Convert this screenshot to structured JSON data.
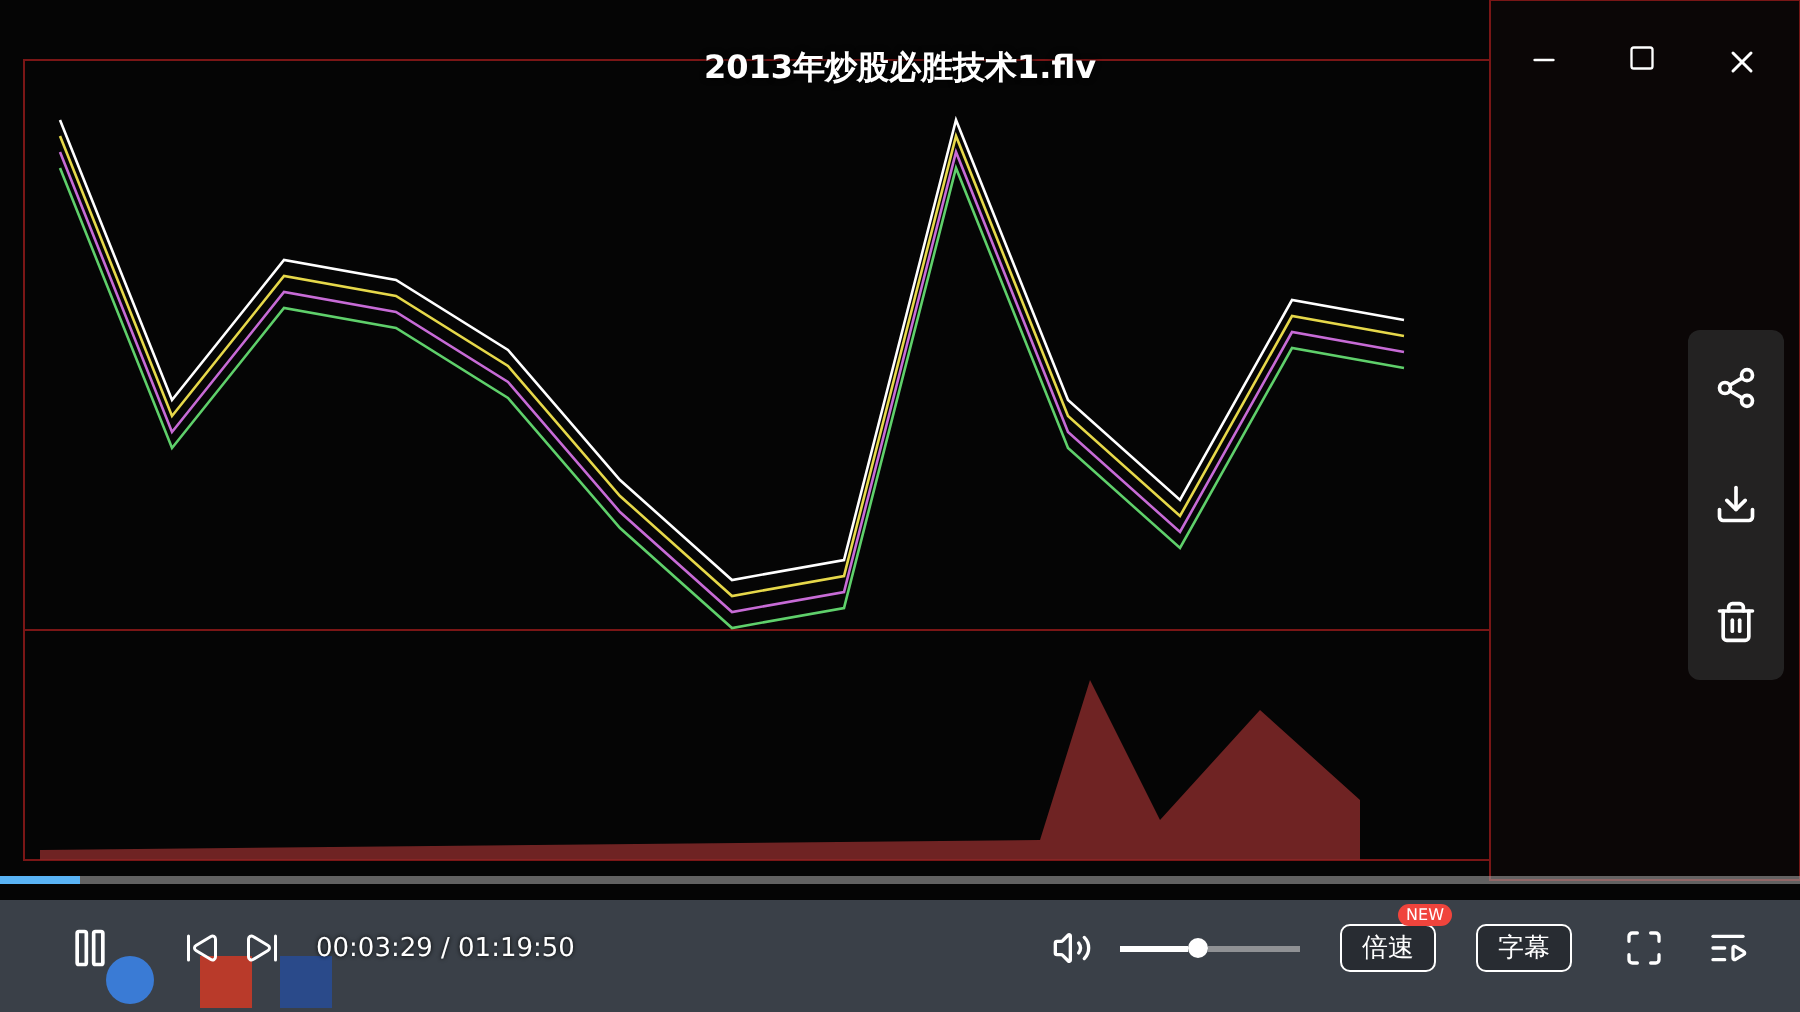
{
  "title": "2013年炒股必胜技术1.flv",
  "progress": {
    "level": 0.044
  },
  "controls": {
    "time": "00:03:29 / 01:19:50",
    "volume": {
      "level": 0.42,
      "muted": false
    },
    "buttons": [
      {
        "label": "倍速",
        "badge": "NEW"
      },
      {
        "label": "字幕"
      }
    ]
  }
}
